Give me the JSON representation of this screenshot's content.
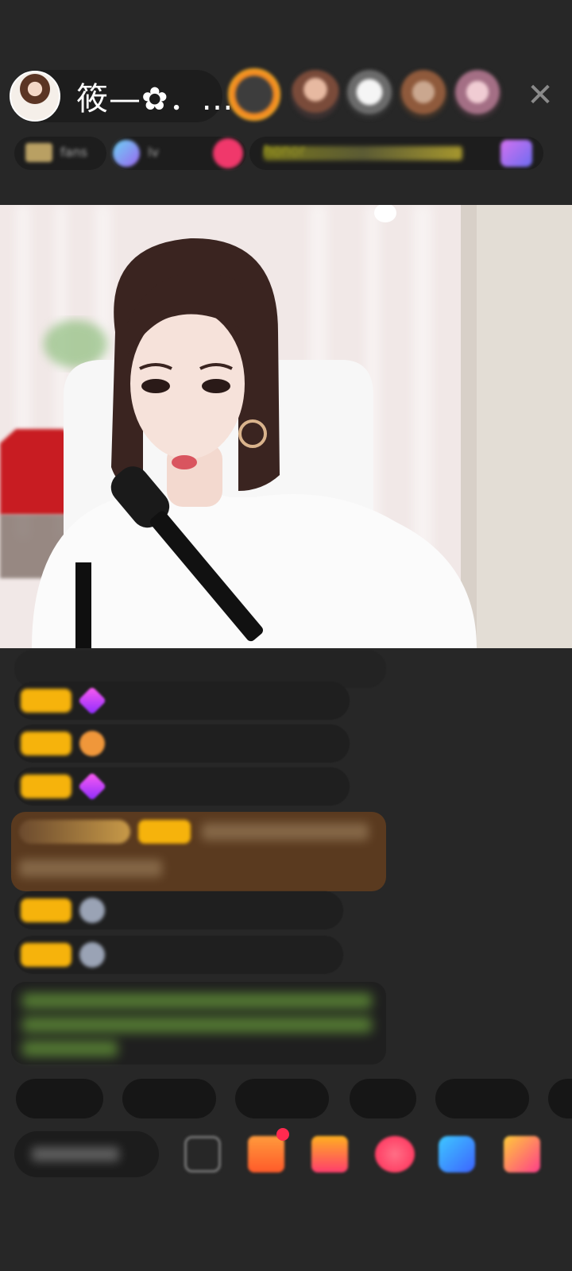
{
  "header": {
    "host_name": "筱—✿．…",
    "viewer_ranks": [
      "",
      "",
      "",
      ""
    ],
    "close_icon": "✕"
  },
  "badges": {
    "fans_club": "fans",
    "level_text": "lv",
    "honor_text": "honor"
  },
  "chat": {
    "messages": [
      {
        "level": "",
        "name": "",
        "meta": "",
        "text": ""
      },
      {
        "level": "",
        "name": "",
        "meta": "",
        "text": ""
      },
      {
        "level": "",
        "name": "",
        "meta": "",
        "text": ""
      },
      {
        "level": "",
        "name": "",
        "meta": "",
        "text": ""
      },
      {
        "level": "",
        "name": "",
        "meta": "",
        "text": ""
      },
      {
        "level": "",
        "name": "",
        "meta": "",
        "text": ""
      }
    ],
    "welcome_notice": "",
    "gift_notice": ""
  },
  "quick_replies": [
    "",
    "",
    "",
    "",
    ""
  ],
  "input": {
    "placeholder": ""
  },
  "colors": {
    "level_badge": "#f6b30c",
    "background": "#272727",
    "green_notice": "#7fc443",
    "cyan_name": "#32c7df",
    "purple_name": "#c89bf0"
  }
}
